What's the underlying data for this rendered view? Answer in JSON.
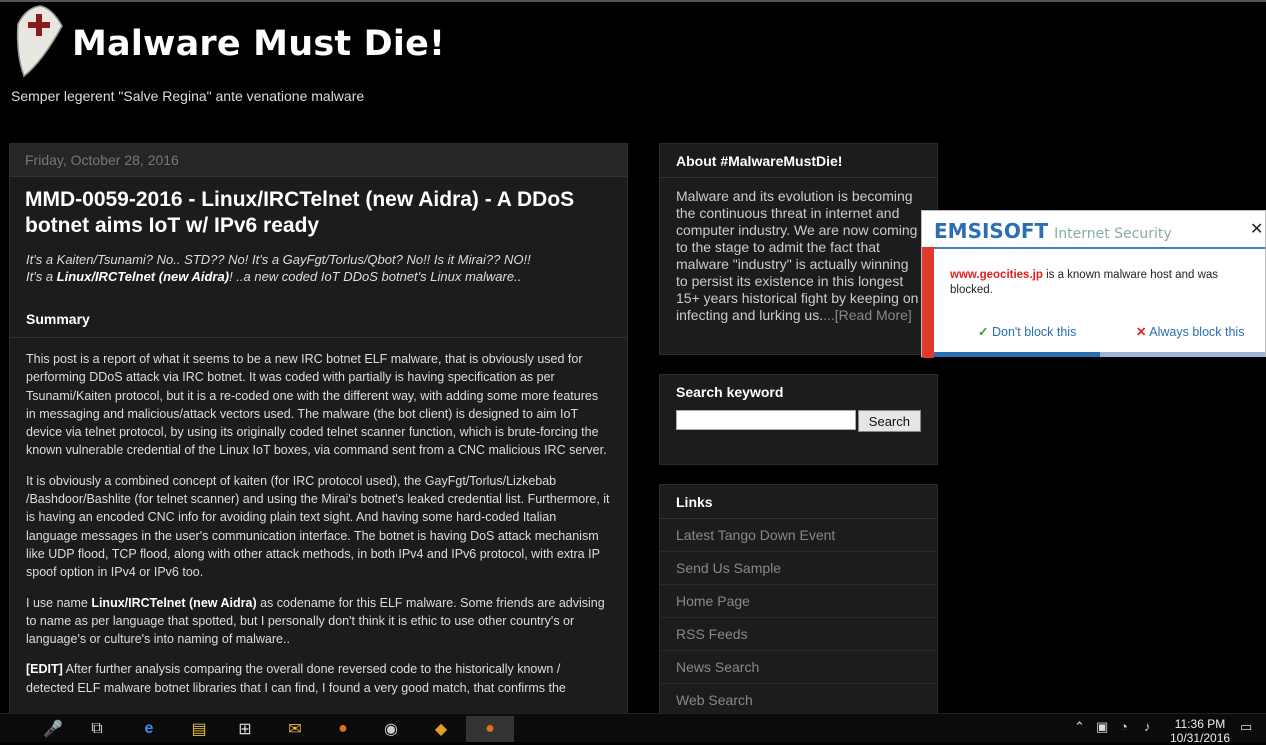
{
  "header": {
    "title": "Malware Must Die!",
    "description": "Semper legerent \"Salve Regina\" ante venatione malware"
  },
  "post": {
    "date": "Friday, October 28, 2016",
    "title": "MMD-0059-2016 - Linux/IRCTelnet (new Aidra) - A DDoS botnet aims IoT w/ IPv6 ready",
    "teaser_line1": "It's a Kaiten/Tsunami? No.. STD?? No! It's a GayFgt/Torlus/Qbot? No!! Is it Mirai?? NO!!",
    "teaser_line2_pre": "It's a ",
    "teaser_line2_bold": "Linux/IRCTelnet (new Aidra)",
    "teaser_line2_post": "! ..a new coded IoT DDoS botnet's Linux malware..",
    "summary_heading": "Summary",
    "para1": "This post is a report of what it seems to be a new IRC botnet ELF malware, that is obviously used for performing DDoS attack via IRC botnet. It was coded with partially is having specification as per Tsunami/Kaiten protocol, but it is a re-coded one with the different way, with adding some more features in messaging and malicious/attack vectors used. The malware (the bot client) is designed to aim IoT device via telnet protocol, by using its originally coded telnet scanner function, which is brute-forcing the known vulnerable credential of the Linux IoT boxes, via command sent from a CNC malicious IRC server.",
    "para2": "It is obviously a combined concept of kaiten (for IRC protocol used), the GayFgt/Torlus/Lizkebab /Bashdoor/Bashlite (for telnet scanner) and using the Mirai's botnet's leaked credential list. Furthermore, it is having an encoded CNC info for avoiding plain text sight. And having some hard-coded Italian language messages in the user's communication interface. The botnet is having DoS attack mechanism like UDP flood, TCP flood, along with other attack methods, in both IPv4 and IPv6 protocol, with extra IP spoof option in IPv4 or IPv6 too.",
    "para3_pre": "I use name ",
    "para3_bold": "Linux/IRCTelnet (new Aidra)",
    "para3_post": " as codename for this ELF malware. Some friends are advising to name as per language that spotted, but I personally don't think it is ethic to use other country's or language's or culture's into naming of malware..",
    "para4_bold": "[EDIT]",
    "para4_post": " After further analysis comparing the overall done reversed code to the historically known / detected ELF malware botnet libraries that I can find, I found a very good match, that confirms the"
  },
  "sidebar": {
    "about": {
      "heading": "About #MalwareMustDie!",
      "text": "Malware and its evolution is becoming the continuous threat in internet and computer industry. We are now coming to the stage to admit the fact that malware \"industry\" is actually winning to persist its existence in this longest 15+ years historical fight by keeping on infecting and lurking us.",
      "read_more": "...[Read More]"
    },
    "search": {
      "heading": "Search keyword",
      "input_value": "",
      "button_label": "Search"
    },
    "links": {
      "heading": "Links",
      "items": [
        "Latest Tango Down Event",
        "Send Us Sample",
        "Home Page",
        "RSS Feeds",
        "News Search",
        "Web Search"
      ]
    }
  },
  "popup": {
    "brand": "EMSISOFT",
    "product": "Internet Security",
    "host": "www.geocities.jp",
    "message": " is a known malware host and was blocked.",
    "dont_block": "Don't block this",
    "always_block": "Always block this",
    "progress": 0.5,
    "accent_color": "#2a6fb0",
    "alert_color": "#e03a2a"
  },
  "taskbar": {
    "time": "11:36 PM",
    "date": "10/31/2016"
  }
}
